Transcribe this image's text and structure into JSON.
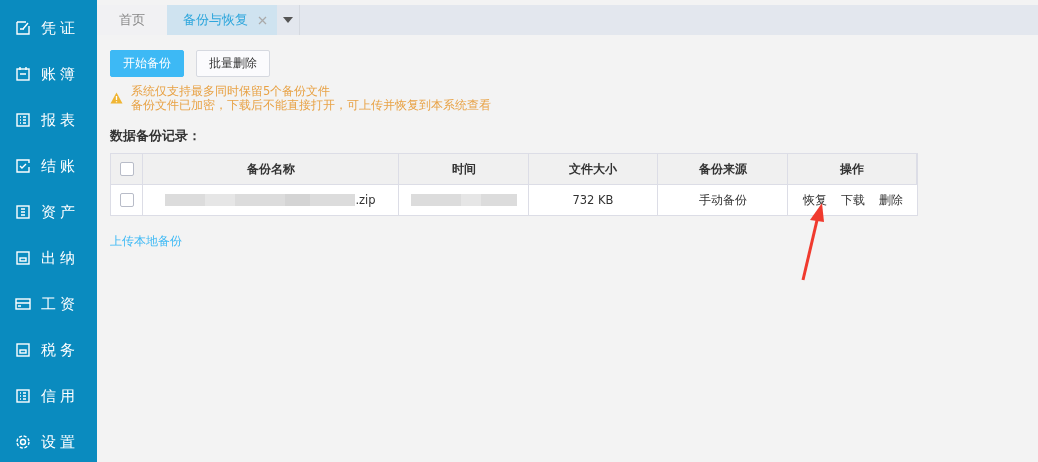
{
  "sidebar": {
    "items": [
      {
        "label": "凭证"
      },
      {
        "label": "账簿"
      },
      {
        "label": "报表"
      },
      {
        "label": "结账"
      },
      {
        "label": "资产"
      },
      {
        "label": "出纳"
      },
      {
        "label": "工资"
      },
      {
        "label": "税务"
      },
      {
        "label": "信用"
      },
      {
        "label": "设置"
      }
    ]
  },
  "tabs": [
    {
      "label": "首页",
      "selected": false,
      "closable": false
    },
    {
      "label": "备份与恢复",
      "selected": true,
      "closable": true
    }
  ],
  "toolbar": {
    "buttons": [
      {
        "label": "开始备份",
        "kind": "primary"
      },
      {
        "label": "批量删除",
        "kind": "default"
      }
    ]
  },
  "notice": [
    "系统仅支持最多同时保留5个备份文件",
    "备份文件已加密，下载后不能直接打开，可上传并恢复到本系统查看"
  ],
  "section_title": "数据备份记录：",
  "table": {
    "all_checked": false,
    "columns": [
      "备份名称",
      "时间",
      "文件大小",
      "备份来源",
      "操作"
    ],
    "rows": [
      {
        "checked": false,
        "name": ".zip",
        "size": "732 KB",
        "source": "手动备份",
        "actions": [
          "恢复",
          "下载",
          "删除"
        ]
      }
    ]
  },
  "upload_link": "上传本地备份"
}
